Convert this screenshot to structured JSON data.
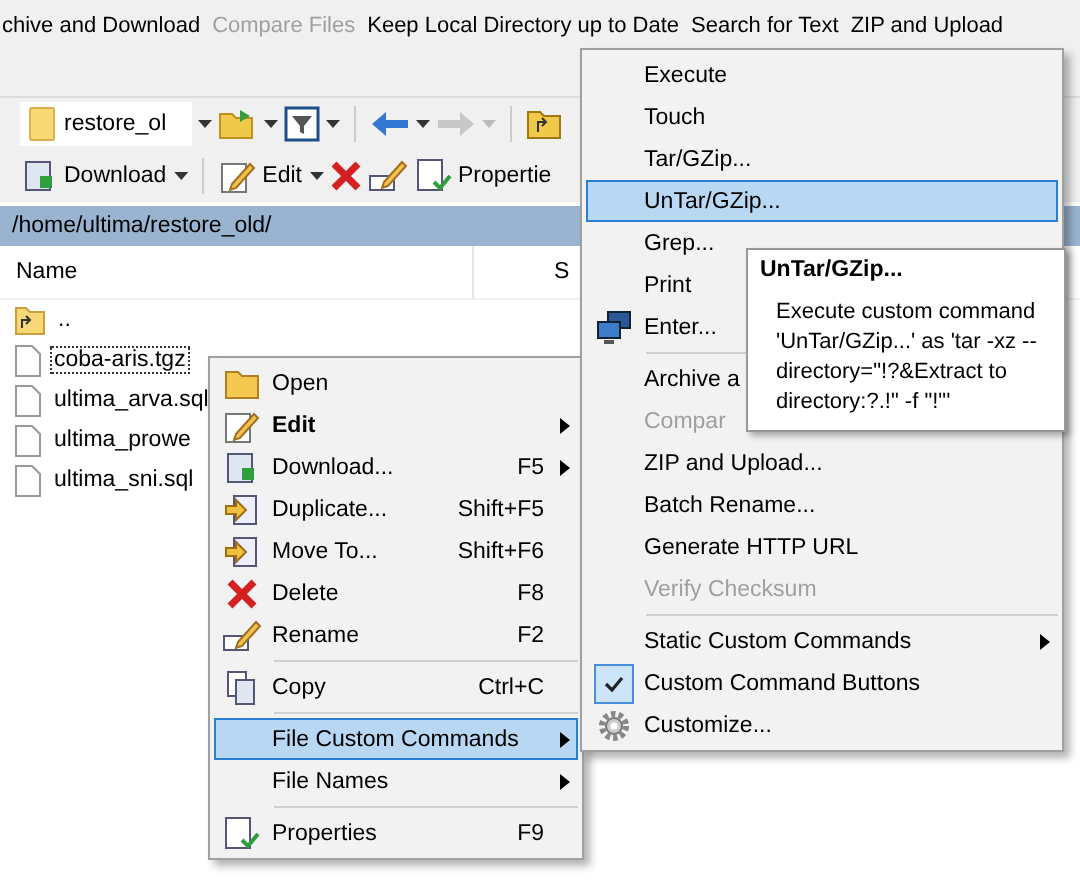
{
  "custom_command_bar": [
    {
      "label": "chive and Download",
      "disabled": false
    },
    {
      "label": "Compare Files",
      "disabled": true
    },
    {
      "label": "Keep Local Directory up to Date",
      "disabled": false
    },
    {
      "label": "Search for Text",
      "disabled": false
    },
    {
      "label": "ZIP and Upload",
      "disabled": false
    }
  ],
  "location_toolbar": {
    "folder": "restore_ol"
  },
  "action_toolbar": {
    "buttons": [
      "Download",
      "Edit",
      "Propertie"
    ]
  },
  "path": "/home/ultima/restore_old/",
  "file_list": {
    "columns": [
      "Name",
      "S"
    ],
    "rows": [
      {
        "name": "..",
        "kind": "parent",
        "focused": false
      },
      {
        "name": "coba-aris.tgz",
        "kind": "file",
        "focused": true
      },
      {
        "name": "ultima_arva.sql",
        "kind": "file",
        "focused": false
      },
      {
        "name": "ultima_prowe",
        "kind": "file",
        "focused": false
      },
      {
        "name": "ultima_sni.sql",
        "kind": "file",
        "focused": false
      }
    ]
  },
  "context_menu": [
    {
      "kind": "item",
      "label": "Open",
      "bold": false,
      "submenu": false,
      "selected": false
    },
    {
      "kind": "item",
      "label": "Edit",
      "bold": true,
      "submenu": true,
      "selected": false
    },
    {
      "kind": "item",
      "label": "Download...",
      "shortcut": "F5",
      "bold": false,
      "submenu": true,
      "selected": false
    },
    {
      "kind": "item",
      "label": "Duplicate...",
      "shortcut": "Shift+F5",
      "bold": false,
      "submenu": false,
      "selected": false
    },
    {
      "kind": "item",
      "label": "Move To...",
      "shortcut": "Shift+F6",
      "bold": false,
      "submenu": false,
      "selected": false
    },
    {
      "kind": "item",
      "label": "Delete",
      "shortcut": "F8",
      "bold": false,
      "submenu": false,
      "selected": false
    },
    {
      "kind": "item",
      "label": "Rename",
      "shortcut": "F2",
      "bold": false,
      "submenu": false,
      "selected": false
    },
    {
      "kind": "separator"
    },
    {
      "kind": "item",
      "label": "Copy",
      "shortcut": "Ctrl+C",
      "bold": false,
      "submenu": false,
      "selected": false
    },
    {
      "kind": "separator"
    },
    {
      "kind": "item",
      "label": "File Custom Commands",
      "bold": false,
      "submenu": true,
      "selected": true
    },
    {
      "kind": "item",
      "label": "File Names",
      "bold": false,
      "submenu": true,
      "selected": false
    },
    {
      "kind": "separator"
    },
    {
      "kind": "item",
      "label": "Properties",
      "shortcut": "F9",
      "bold": false,
      "submenu": false,
      "selected": false
    }
  ],
  "submenu": [
    {
      "kind": "item",
      "label": "Execute",
      "disabled": false,
      "selected": false,
      "submenu": false,
      "checked": false
    },
    {
      "kind": "item",
      "label": "Touch",
      "disabled": false,
      "selected": false,
      "submenu": false,
      "checked": false
    },
    {
      "kind": "item",
      "label": "Tar/GZip...",
      "disabled": false,
      "selected": false,
      "submenu": false,
      "checked": false
    },
    {
      "kind": "item",
      "label": "UnTar/GZip...",
      "disabled": false,
      "selected": true,
      "submenu": false,
      "checked": false
    },
    {
      "kind": "item",
      "label": "Grep...",
      "disabled": false,
      "selected": false,
      "checked": false
    },
    {
      "kind": "item",
      "label": "Print",
      "disabled": false,
      "selected": false,
      "checked": false
    },
    {
      "kind": "item",
      "label": "Enter...",
      "disabled": false,
      "selected": false,
      "checked": false
    },
    {
      "kind": "separator"
    },
    {
      "kind": "item",
      "label": "Archive a",
      "disabled": false,
      "selected": false,
      "checked": false
    },
    {
      "kind": "item",
      "label": "Compar",
      "disabled": true,
      "selected": false,
      "checked": false
    },
    {
      "kind": "item",
      "label": "ZIP and Upload...",
      "disabled": false,
      "selected": false,
      "submenu": false,
      "checked": false
    },
    {
      "kind": "item",
      "label": "Batch Rename...",
      "disabled": false,
      "selected": false,
      "submenu": false,
      "checked": false
    },
    {
      "kind": "item",
      "label": "Generate HTTP URL",
      "disabled": false,
      "selected": false,
      "submenu": false,
      "checked": false
    },
    {
      "kind": "item",
      "label": "Verify Checksum",
      "disabled": true,
      "selected": false,
      "submenu": false,
      "checked": false
    },
    {
      "kind": "separator"
    },
    {
      "kind": "item",
      "label": "Static Custom Commands",
      "disabled": false,
      "selected": false,
      "submenu": true,
      "checked": false
    },
    {
      "kind": "item",
      "label": "Custom Command Buttons",
      "disabled": false,
      "selected": false,
      "submenu": false,
      "checked": true
    },
    {
      "kind": "item",
      "label": "Customize...",
      "disabled": false,
      "selected": false,
      "submenu": false,
      "checked": false
    }
  ],
  "tooltip": {
    "title": "UnTar/GZip...",
    "text": "Execute custom command 'UnTar/GZip...' as 'tar -xz --directory=\"!?&Extract to directory:?.!\" -f \"!\"'"
  }
}
